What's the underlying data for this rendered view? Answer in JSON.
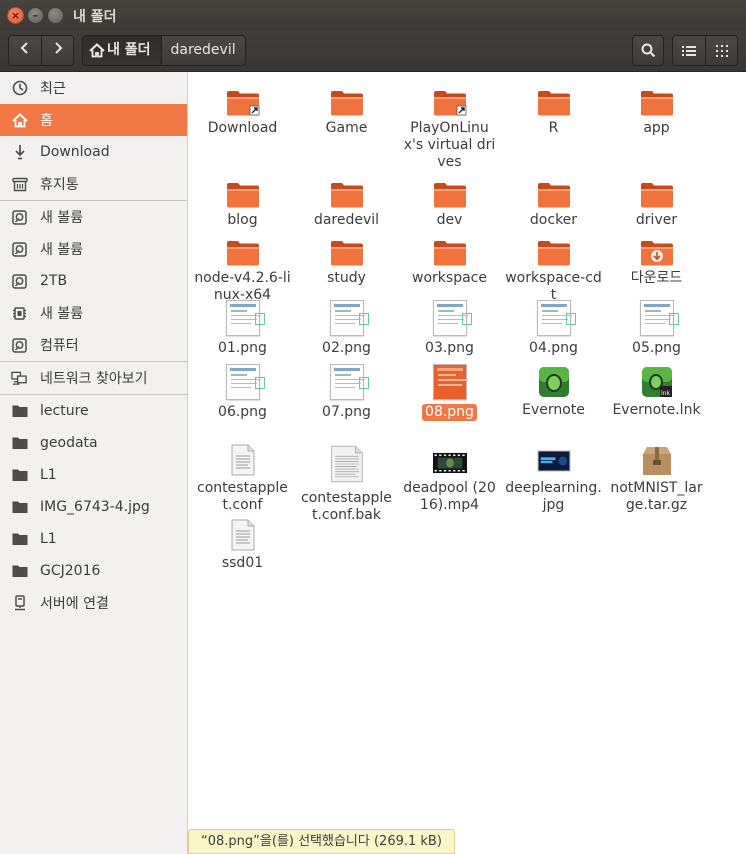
{
  "window": {
    "title": "내 폴더"
  },
  "toolbar": {
    "back_icon": "chevron-left-icon",
    "forward_icon": "chevron-right-icon",
    "path": [
      {
        "label": "내 폴더",
        "icon": "home-icon"
      },
      {
        "label": "daredevil"
      }
    ],
    "search_icon": "search-icon",
    "list_view_icon": "list-icon",
    "grid_view_icon": "grid-icon"
  },
  "sidebar": {
    "items": [
      {
        "label": "최근",
        "icon": "clock-icon"
      },
      {
        "label": "홈",
        "icon": "home-icon",
        "selected": true
      },
      {
        "label": "Download",
        "icon": "download-icon"
      },
      {
        "label": "휴지통",
        "icon": "trash-icon"
      },
      {
        "label": "새 볼륨",
        "icon": "drive-icon"
      },
      {
        "label": "새 볼륨",
        "icon": "drive-icon"
      },
      {
        "label": "2TB",
        "icon": "drive-icon"
      },
      {
        "label": "새 볼륨",
        "icon": "chip-icon"
      },
      {
        "label": "컴퓨터",
        "icon": "drive-icon"
      },
      {
        "label": "네트워크 찾아보기",
        "icon": "network-icon"
      },
      {
        "label": "lecture",
        "icon": "folder-icon"
      },
      {
        "label": "geodata",
        "icon": "folder-icon"
      },
      {
        "label": "L1",
        "icon": "folder-icon"
      },
      {
        "label": "IMG_6743-4.jpg",
        "icon": "folder-icon"
      },
      {
        "label": "L1",
        "icon": "folder-icon"
      },
      {
        "label": "GCJ2016",
        "icon": "folder-icon"
      },
      {
        "label": "서버에 연결",
        "icon": "server-icon"
      }
    ]
  },
  "files": [
    {
      "name": "Download",
      "type": "folder-link"
    },
    {
      "name": "Game",
      "type": "folder"
    },
    {
      "name": "PlayOnLinux's virtual drives",
      "type": "folder-link"
    },
    {
      "name": "R",
      "type": "folder"
    },
    {
      "name": "app",
      "type": "folder"
    },
    {
      "name": "blog",
      "type": "folder"
    },
    {
      "name": "daredevil",
      "type": "folder"
    },
    {
      "name": "dev",
      "type": "folder"
    },
    {
      "name": "docker",
      "type": "folder"
    },
    {
      "name": "driver",
      "type": "folder"
    },
    {
      "name": "node-v4.2.6-linux-x64",
      "type": "folder"
    },
    {
      "name": "study",
      "type": "folder"
    },
    {
      "name": "workspace",
      "type": "folder"
    },
    {
      "name": "workspace-cdt",
      "type": "folder"
    },
    {
      "name": "다운로드",
      "type": "folder-download"
    },
    {
      "name": "01.png",
      "type": "image"
    },
    {
      "name": "02.png",
      "type": "image"
    },
    {
      "name": "03.png",
      "type": "image"
    },
    {
      "name": "04.png",
      "type": "image"
    },
    {
      "name": "05.png",
      "type": "image"
    },
    {
      "name": "06.png",
      "type": "image"
    },
    {
      "name": "07.png",
      "type": "image"
    },
    {
      "name": "08.png",
      "type": "image",
      "selected": true
    },
    {
      "name": "Evernote",
      "type": "evernote"
    },
    {
      "name": "Evernote.lnk",
      "type": "evernote-link"
    },
    {
      "name": "contestapplet.conf",
      "type": "text"
    },
    {
      "name": "contestapplet.conf.bak",
      "type": "text-large"
    },
    {
      "name": "deadpool (2016).mp4",
      "type": "video"
    },
    {
      "name": "deeplearning.jpg",
      "type": "photo"
    },
    {
      "name": "notMNIST_large.tar.gz",
      "type": "archive"
    },
    {
      "name": "ssd01",
      "type": "text"
    }
  ],
  "status": {
    "text": "“08.png”을(를) 선택했습니다  (269.1 kB)"
  },
  "colors": {
    "accent": "#f07746",
    "folder": "#f07746",
    "headerbar": "#3c3b37"
  }
}
